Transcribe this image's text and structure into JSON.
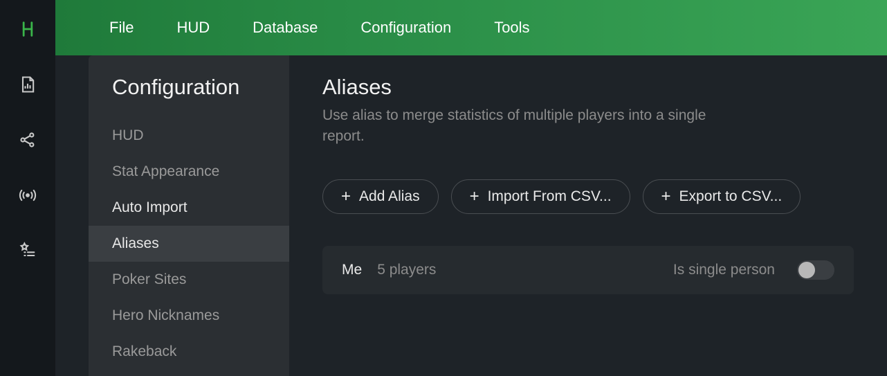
{
  "rail": {
    "icons": [
      "logo",
      "document-chart",
      "share",
      "broadcast",
      "star-list"
    ]
  },
  "topbar": {
    "items": [
      "File",
      "HUD",
      "Database",
      "Configuration",
      "Tools"
    ]
  },
  "config": {
    "title": "Configuration",
    "items": [
      {
        "label": "HUD",
        "active": false,
        "emph": false
      },
      {
        "label": "Stat Appearance",
        "active": false,
        "emph": false
      },
      {
        "label": "Auto Import",
        "active": false,
        "emph": true
      },
      {
        "label": "Aliases",
        "active": true,
        "emph": true
      },
      {
        "label": "Poker Sites",
        "active": false,
        "emph": false
      },
      {
        "label": "Hero Nicknames",
        "active": false,
        "emph": false
      },
      {
        "label": "Rakeback",
        "active": false,
        "emph": false
      }
    ]
  },
  "detail": {
    "title": "Aliases",
    "description": "Use alias to merge statistics of multiple players into a single report.",
    "buttons": {
      "add": "Add Alias",
      "import": "Import From CSV...",
      "export": "Export to CSV..."
    },
    "alias_row": {
      "name": "Me",
      "count_label": "5 players",
      "toggle_label": "Is single person",
      "toggle_on": false
    }
  }
}
